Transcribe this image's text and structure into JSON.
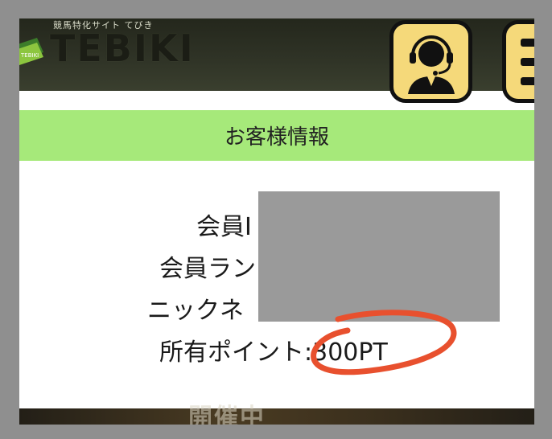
{
  "header": {
    "tagline": "競馬特化サイト てびき",
    "logo_text": "TEBIKI",
    "logo_mark_text": "TEBIKI",
    "support_icon": "customer-support-headset-icon",
    "menu_icon": "hamburger-menu-icon"
  },
  "section": {
    "title": "お客様情報"
  },
  "info": {
    "member_id_label": "会員I",
    "member_rank_label": "会員ラン",
    "nickname_label": "ニックネ",
    "points_label": "所有ポイント",
    "points_value": ":300PT"
  },
  "banner": {
    "text": "開催中"
  },
  "colors": {
    "header_bg": "#2f3326",
    "button_bg": "#f5d97a",
    "section_bg": "#a6e97a",
    "redaction": "#9a9a9a",
    "annotation": "#e8502e"
  }
}
